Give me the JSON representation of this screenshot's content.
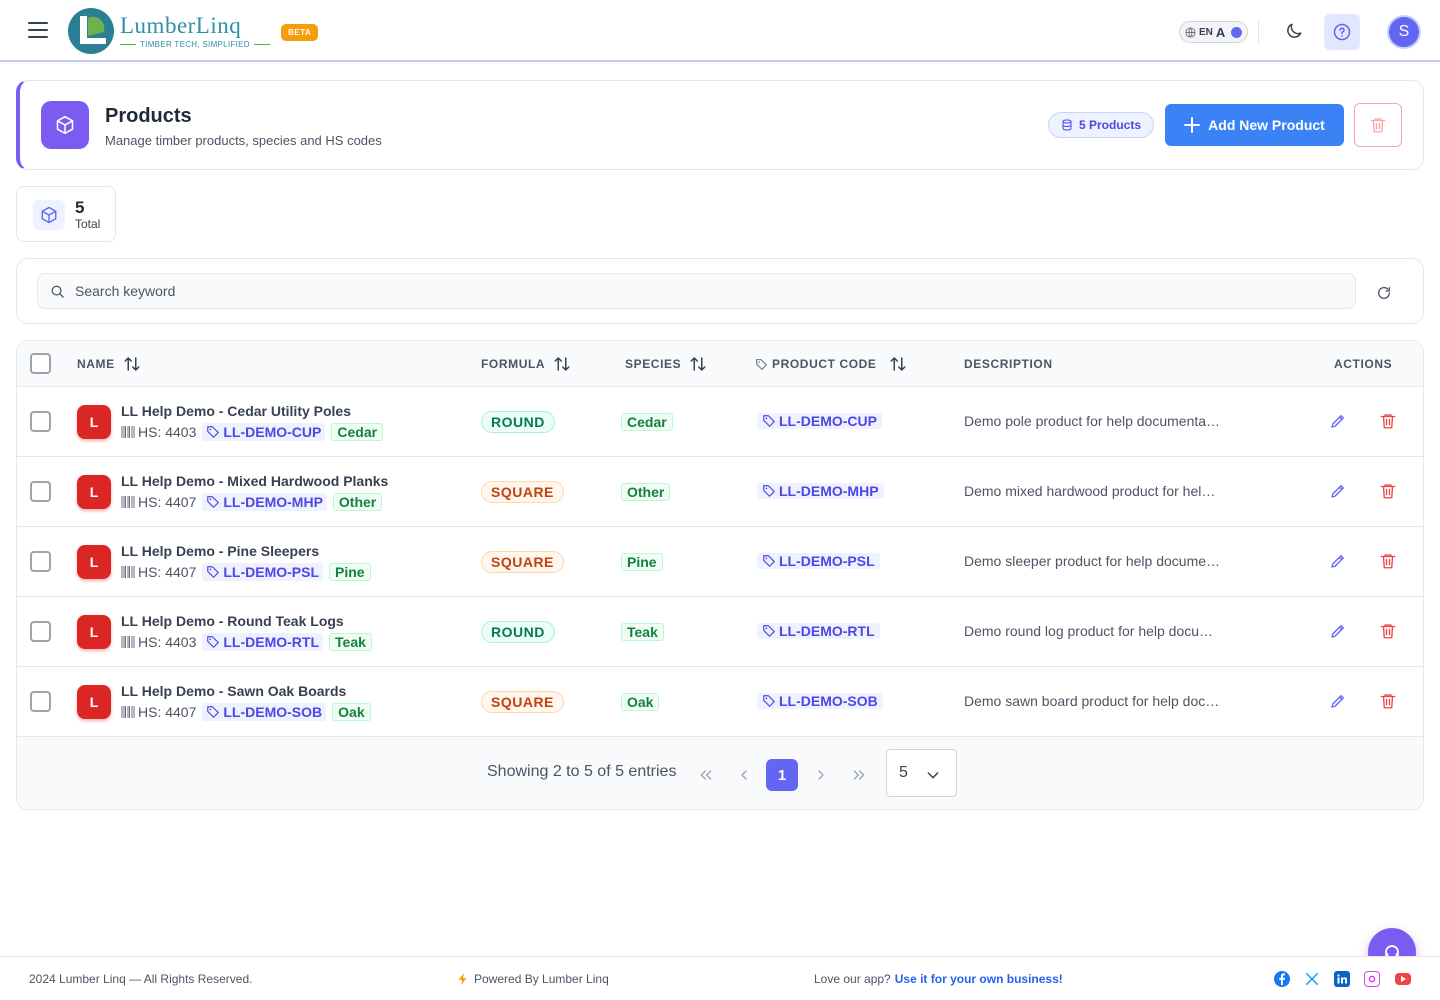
{
  "header": {
    "logo_name": "LumberLinq",
    "logo_tagline": "TIMBER TECH, SIMPLIFIED",
    "beta_label": "BETA",
    "lang_code": "EN",
    "font_toggle": "A",
    "avatar_initial": "S"
  },
  "page": {
    "title": "Products",
    "subtitle": "Manage timber products, species and HS codes",
    "count_badge": "5 Products",
    "add_button": "Add New Product"
  },
  "stats": {
    "total_value": "5",
    "total_label": "Total"
  },
  "search": {
    "placeholder": "Search keyword"
  },
  "table": {
    "columns": {
      "name": "NAME",
      "formula": "FORMULA",
      "species": "SPECIES",
      "product_code": "PRODUCT CODE",
      "description": "DESCRIPTION",
      "actions": "ACTIONS"
    },
    "rows": [
      {
        "avatar": "L",
        "name": "LL Help Demo - Cedar Utility Poles",
        "hs": "HS: 4403",
        "code": "LL-DEMO-CUP",
        "species": "Cedar",
        "formula": "ROUND",
        "description": "Demo pole product for help documentati…"
      },
      {
        "avatar": "L",
        "name": "LL Help Demo - Mixed Hardwood Planks",
        "hs": "HS: 4407",
        "code": "LL-DEMO-MHP",
        "species": "Other",
        "formula": "SQUARE",
        "description": "Demo mixed hardwood product for help …"
      },
      {
        "avatar": "L",
        "name": "LL Help Demo - Pine Sleepers",
        "hs": "HS: 4407",
        "code": "LL-DEMO-PSL",
        "species": "Pine",
        "formula": "SQUARE",
        "description": "Demo sleeper product for help documen…"
      },
      {
        "avatar": "L",
        "name": "LL Help Demo - Round Teak Logs",
        "hs": "HS: 4403",
        "code": "LL-DEMO-RTL",
        "species": "Teak",
        "formula": "ROUND",
        "description": "Demo round log product for help docum…"
      },
      {
        "avatar": "L",
        "name": "LL Help Demo - Sawn Oak Boards",
        "hs": "HS: 4407",
        "code": "LL-DEMO-SOB",
        "species": "Oak",
        "formula": "SQUARE",
        "description": "Demo sawn board product for help docu…"
      }
    ]
  },
  "pagination": {
    "showing": "Showing 2 to 5 of 5 entries",
    "current_page": "1",
    "per_page": "5"
  },
  "footer": {
    "copyright": "2024 Lumber Linq — All Rights Reserved.",
    "powered": "Powered By Lumber Linq",
    "love": "Love our app?",
    "cta": "Use it for your own business!"
  },
  "colors": {
    "accent": "#6366f1",
    "primary_button": "#3b82f6",
    "header_icon": "#7c5cf0",
    "avatar_red": "#dc2626"
  },
  "icons": [
    "menu-icon",
    "globe-icon",
    "moon-icon",
    "help-icon",
    "cube-icon",
    "database-icon",
    "plus-icon",
    "trash-icon",
    "search-icon",
    "refresh-icon",
    "sort-icon",
    "tag-icon",
    "barcode-icon",
    "edit-icon",
    "chevron-icon",
    "headset-icon",
    "bolt-icon",
    "facebook-icon",
    "x-icon",
    "linkedin-icon",
    "instagram-icon",
    "youtube-icon"
  ]
}
